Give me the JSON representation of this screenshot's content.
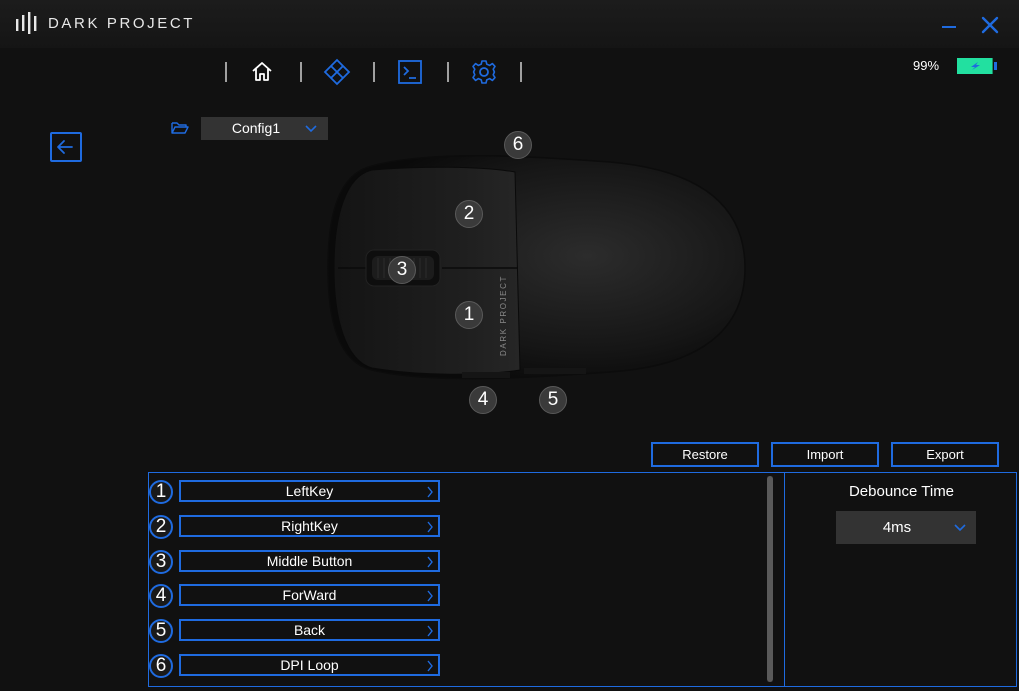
{
  "app": {
    "brand": "DARK PROJECT"
  },
  "toolbar": {
    "nav": [
      {
        "icon": "home-icon",
        "active": false
      },
      {
        "icon": "diamond-grid-icon",
        "active": true
      },
      {
        "icon": "terminal-icon",
        "active": false
      },
      {
        "icon": "gear-icon",
        "active": false
      }
    ]
  },
  "battery": {
    "percent_label": "99%",
    "level": 0.99,
    "charging": true,
    "color": "#22e0a0"
  },
  "config": {
    "selected": "Config1"
  },
  "mouse": {
    "body_text": "DARK PROJECT",
    "badges": [
      "1",
      "2",
      "3",
      "4",
      "5",
      "6"
    ]
  },
  "actions": {
    "restore": "Restore",
    "import": "Import",
    "export": "Export"
  },
  "key_mappings": [
    {
      "number": "1",
      "label": "LeftKey"
    },
    {
      "number": "2",
      "label": "RightKey"
    },
    {
      "number": "3",
      "label": "Middle Button"
    },
    {
      "number": "4",
      "label": "ForWard"
    },
    {
      "number": "5",
      "label": "Back"
    },
    {
      "number": "6",
      "label": "DPI Loop"
    }
  ],
  "debounce": {
    "title": "Debounce Time",
    "value": "4ms"
  },
  "colors": {
    "accent": "#1f6be0",
    "background": "#111111",
    "panel": "#333333"
  }
}
